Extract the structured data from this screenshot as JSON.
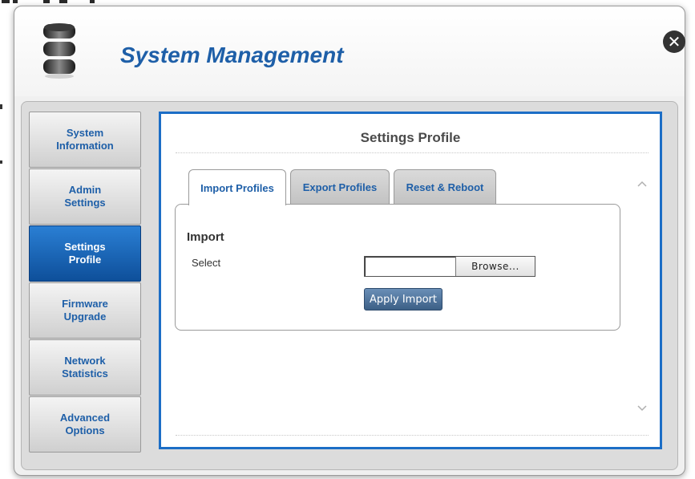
{
  "dialog": {
    "title": "System Management",
    "icon": "database-icon",
    "close_icon": "close-icon"
  },
  "sidebar": {
    "items": [
      {
        "line1": "System",
        "line2": "Information",
        "active": false
      },
      {
        "line1": "Admin",
        "line2": "Settings",
        "active": false
      },
      {
        "line1": "Settings",
        "line2": "Profile",
        "active": true
      },
      {
        "line1": "Firmware",
        "line2": "Upgrade",
        "active": false
      },
      {
        "line1": "Network",
        "line2": "Statistics",
        "active": false
      },
      {
        "line1": "Advanced",
        "line2": "Options",
        "active": false
      }
    ]
  },
  "content": {
    "title": "Settings Profile",
    "tabs": [
      {
        "label": "Import Profiles",
        "active": true
      },
      {
        "label": "Export Profiles",
        "active": false
      },
      {
        "label": "Reset & Reboot",
        "active": false
      }
    ],
    "import": {
      "section_title": "Import",
      "select_label": "Select",
      "file_value": "",
      "browse_label": "Browse...",
      "apply_label": "Apply Import"
    }
  },
  "colors": {
    "accent": "#1e5fa8",
    "active_nav": "#0e4f9a",
    "frame_border": "#1c6ec6",
    "apply_button": "#4a6e96"
  }
}
